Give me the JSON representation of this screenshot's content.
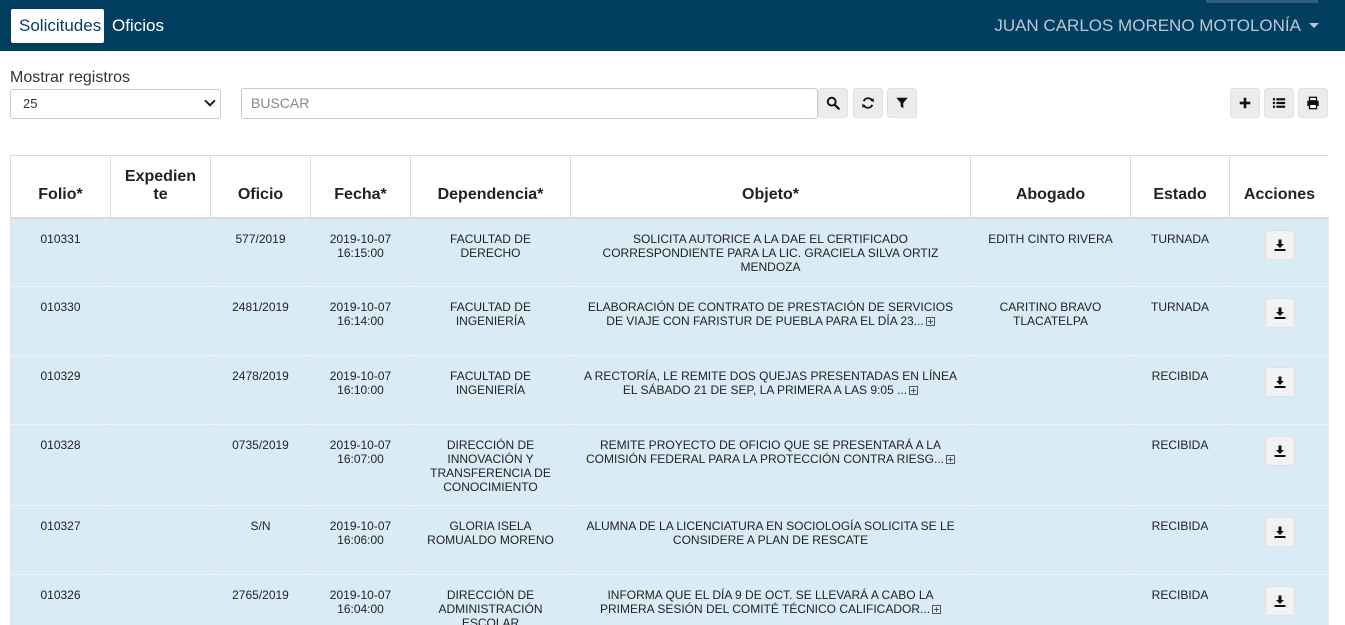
{
  "nav": {
    "tabs": [
      "Solicitudes",
      "Oficios"
    ],
    "user": "JUAN CARLOS MORENO MOTOLONÍA"
  },
  "toolbar": {
    "show_label": "Mostrar registros",
    "page_size": "25",
    "search_placeholder": "BUSCAR"
  },
  "table": {
    "headers": [
      "Folio*",
      "Expediente",
      "Oficio",
      "Fecha*",
      "Dependencia*",
      "Objeto*",
      "Abogado",
      "Estado",
      "Acciones"
    ],
    "rows": [
      {
        "folio": "010331",
        "expediente": "",
        "oficio": "577/2019",
        "fecha_date": "2019-10-07",
        "fecha_time": "16:15:00",
        "dependencia": "FACULTAD DE DERECHO",
        "objeto": "SOLICITA AUTORICE A LA DAE EL CERTIFICADO CORRESPONDIENTE PARA LA LIC. GRACIELA SILVA ORTIZ MENDOZA",
        "objeto_more": false,
        "abogado": "EDITH CINTO RIVERA",
        "estado": "TURNADA"
      },
      {
        "folio": "010330",
        "expediente": "",
        "oficio": "2481/2019",
        "fecha_date": "2019-10-07",
        "fecha_time": "16:14:00",
        "dependencia": "FACULTAD DE INGENIERÍA",
        "objeto": "ELABORACIÓN DE CONTRATO DE PRESTACIÓN DE SERVICIOS DE VIAJE CON FARISTUR DE PUEBLA PARA EL DÍA 23...",
        "objeto_more": true,
        "abogado": "CARITINO BRAVO TLACATELPA",
        "estado": "TURNADA"
      },
      {
        "folio": "010329",
        "expediente": "",
        "oficio": "2478/2019",
        "fecha_date": "2019-10-07",
        "fecha_time": "16:10:00",
        "dependencia": "FACULTAD DE INGENIERÍA",
        "objeto": "A RECTORÍA, LE REMITE DOS QUEJAS PRESENTADAS EN LÍNEA EL SÁBADO 21 DE SEP, LA PRIMERA A LAS 9:05 ...",
        "objeto_more": true,
        "abogado": "",
        "estado": "RECIBIDA"
      },
      {
        "folio": "010328",
        "expediente": "",
        "oficio": "0735/2019",
        "fecha_date": "2019-10-07",
        "fecha_time": "16:07:00",
        "dependencia": "DIRECCIÓN DE INNOVACIÓN Y TRANSFERENCIA DE CONOCIMIENTO",
        "objeto": "REMITE PROYECTO DE OFICIO QUE SE PRESENTARÁ A LA COMISIÓN FEDERAL PARA LA PROTECCIÓN CONTRA RIESG...",
        "objeto_more": true,
        "abogado": "",
        "estado": "RECIBIDA"
      },
      {
        "folio": "010327",
        "expediente": "",
        "oficio": "S/N",
        "fecha_date": "2019-10-07",
        "fecha_time": "16:06:00",
        "dependencia": "GLORIA ISELA ROMUALDO MORENO",
        "objeto": "ALUMNA DE LA LICENCIATURA EN SOCIOLOGÍA SOLICITA SE LE CONSIDERE A PLAN DE RESCATE",
        "objeto_more": false,
        "abogado": "",
        "estado": "RECIBIDA"
      },
      {
        "folio": "010326",
        "expediente": "",
        "oficio": "2765/2019",
        "fecha_date": "2019-10-07",
        "fecha_time": "16:04:00",
        "dependencia": "DIRECCIÓN DE ADMINISTRACIÓN ESCOLAR",
        "objeto": "INFORMA QUE EL DÍA 9 DE OCT. SE LLEVARÁ A CABO LA PRIMERA SESIÓN DEL COMITÉ TÉCNICO CALIFICADOR...",
        "objeto_more": true,
        "abogado": "",
        "estado": "RECIBIDA"
      }
    ]
  },
  "colors": {
    "navbar": "#023e5f",
    "row_bg": "#d9ebf5"
  },
  "icons": [
    "search-icon",
    "refresh-icon",
    "filter-icon",
    "add-icon",
    "list-icon",
    "print-icon",
    "download-icon",
    "expand-icon"
  ]
}
